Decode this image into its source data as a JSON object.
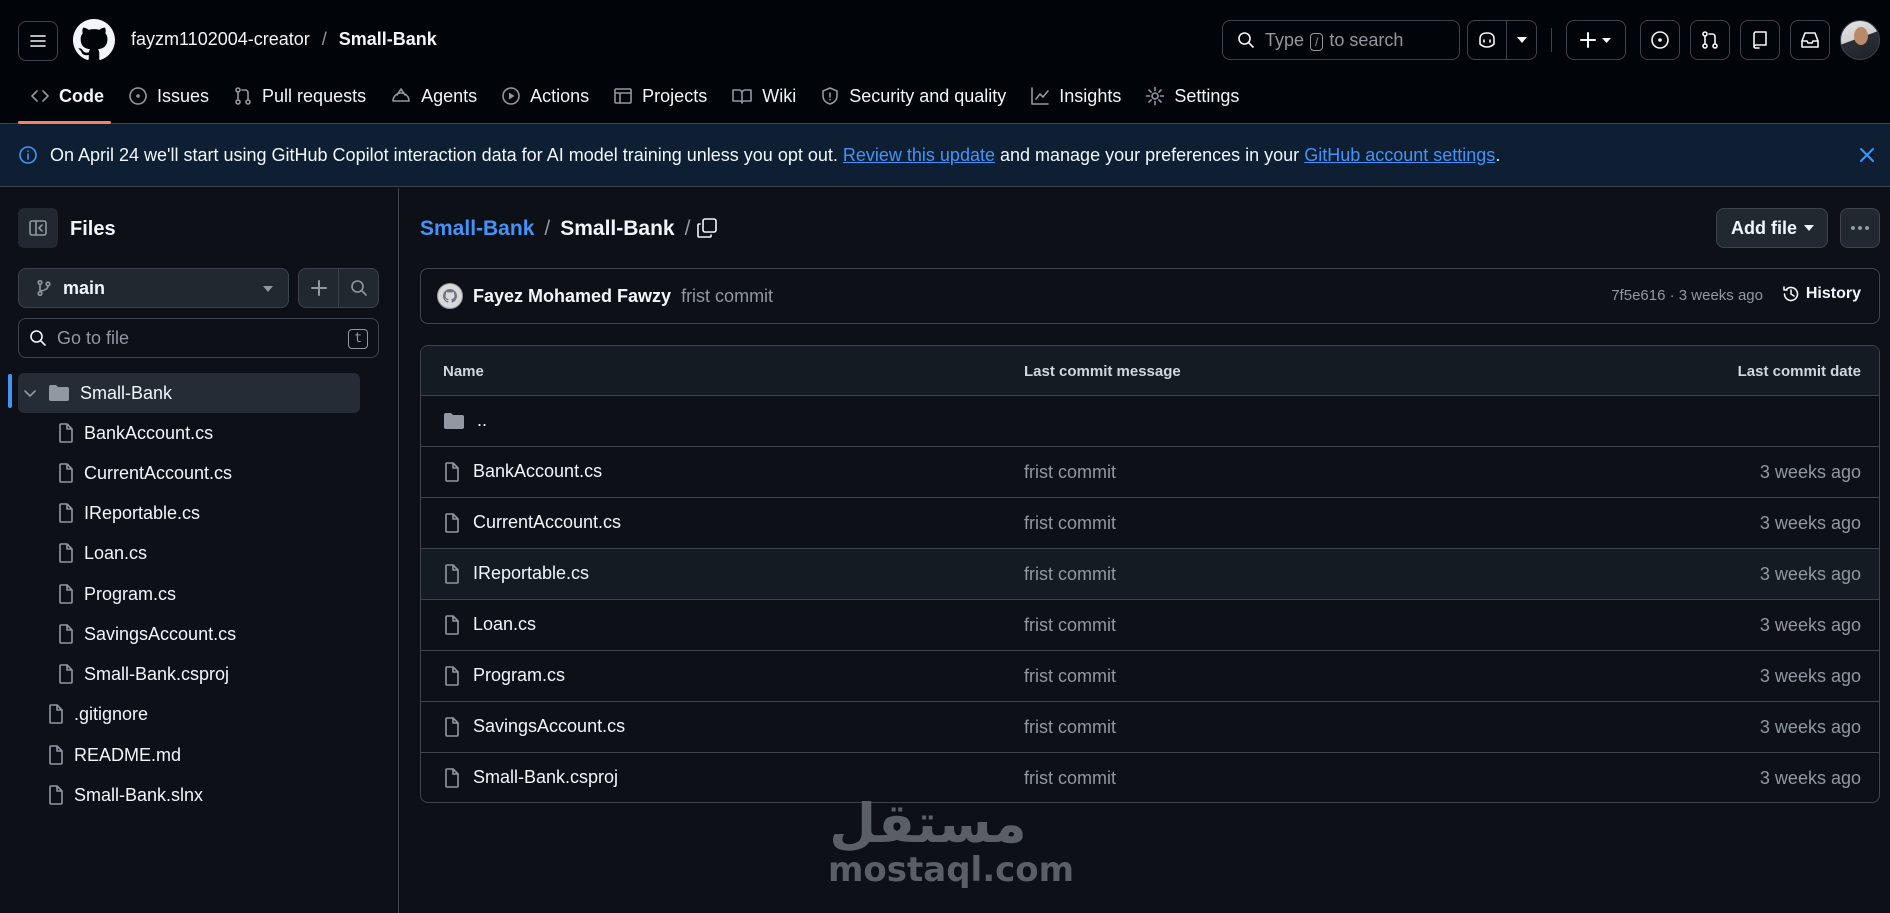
{
  "header": {
    "owner": "fayzm1102004-creator",
    "separator": "/",
    "repo": "Small-Bank",
    "search_prefix": "Type",
    "search_key": "/",
    "search_suffix": "to search"
  },
  "tabs": [
    {
      "label": "Code",
      "icon": "code-icon"
    },
    {
      "label": "Issues",
      "icon": "issue-icon"
    },
    {
      "label": "Pull requests",
      "icon": "pull-request-icon"
    },
    {
      "label": "Agents",
      "icon": "agent-icon"
    },
    {
      "label": "Actions",
      "icon": "play-icon"
    },
    {
      "label": "Projects",
      "icon": "table-icon"
    },
    {
      "label": "Wiki",
      "icon": "book-icon"
    },
    {
      "label": "Security and quality",
      "icon": "shield-icon"
    },
    {
      "label": "Insights",
      "icon": "graph-icon"
    },
    {
      "label": "Settings",
      "icon": "gear-icon"
    }
  ],
  "banner": {
    "text_before": "On April 24 we'll start using GitHub Copilot interaction data for AI model training unless you opt out.",
    "link1": "Review this update",
    "text_middle": "and manage your preferences in your",
    "link2": "GitHub account settings",
    "text_after": "."
  },
  "sidebar": {
    "title": "Files",
    "branch": "main",
    "goto_placeholder": "Go to file",
    "goto_key": "t",
    "tree": [
      {
        "label": "Small-Bank",
        "type": "folder"
      },
      {
        "label": "BankAccount.cs",
        "type": "file"
      },
      {
        "label": "CurrentAccount.cs",
        "type": "file"
      },
      {
        "label": "IReportable.cs",
        "type": "file"
      },
      {
        "label": "Loan.cs",
        "type": "file"
      },
      {
        "label": "Program.cs",
        "type": "file"
      },
      {
        "label": "SavingsAccount.cs",
        "type": "file"
      },
      {
        "label": "Small-Bank.csproj",
        "type": "file"
      },
      {
        "label": ".gitignore",
        "type": "file"
      },
      {
        "label": "README.md",
        "type": "file"
      },
      {
        "label": "Small-Bank.slnx",
        "type": "file"
      }
    ]
  },
  "main": {
    "breadcrumb": [
      "Small-Bank",
      "Small-Bank"
    ],
    "crumb_sep": "/",
    "add_file": "Add file",
    "commit": {
      "author": "Fayez Mohamed Fawzy",
      "message": "frist commit",
      "meta": "7f5e616 · 3 weeks ago",
      "history": "History"
    },
    "table": {
      "headers": {
        "name": "Name",
        "message": "Last commit message",
        "date": "Last commit date"
      },
      "parent": "..",
      "rows": [
        {
          "name": "BankAccount.cs",
          "message": "frist commit",
          "date": "3 weeks ago"
        },
        {
          "name": "CurrentAccount.cs",
          "message": "frist commit",
          "date": "3 weeks ago"
        },
        {
          "name": "IReportable.cs",
          "message": "frist commit",
          "date": "3 weeks ago"
        },
        {
          "name": "Loan.cs",
          "message": "frist commit",
          "date": "3 weeks ago"
        },
        {
          "name": "Program.cs",
          "message": "frist commit",
          "date": "3 weeks ago"
        },
        {
          "name": "SavingsAccount.cs",
          "message": "frist commit",
          "date": "3 weeks ago"
        },
        {
          "name": "Small-Bank.csproj",
          "message": "frist commit",
          "date": "3 weeks ago"
        }
      ]
    }
  },
  "watermark": {
    "arabic": "مستقل",
    "latin": "mostaql.com"
  },
  "colors": {
    "accent": "#4493f8",
    "tab_underline": "#f78166",
    "background": "#0d1117"
  }
}
